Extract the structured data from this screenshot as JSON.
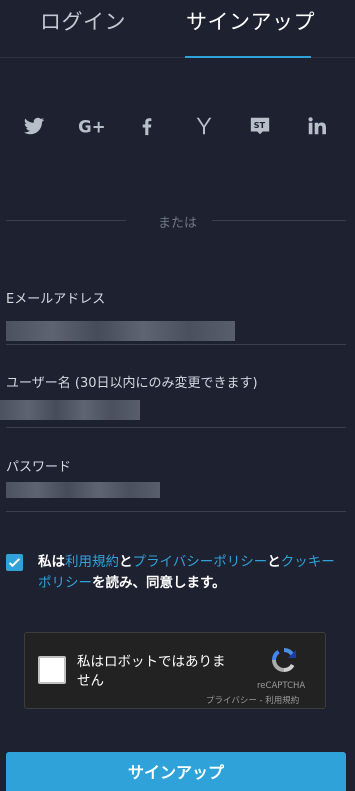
{
  "tabs": {
    "login": "ログイン",
    "signup": "サインアップ"
  },
  "social": [
    "twitter-icon",
    "google-plus-icon",
    "facebook-icon",
    "yahoo-icon",
    "stack-icon",
    "linkedin-icon"
  ],
  "divider": {
    "text": "または"
  },
  "form": {
    "email": {
      "label": "Eメールアドレス"
    },
    "username": {
      "label": "ユーザー名 (30日以内にのみ変更できます)"
    },
    "password": {
      "label": "パスワード"
    }
  },
  "agreement": {
    "checked": true,
    "prefix": "私は",
    "terms": "利用規約",
    "and1": "と",
    "privacy": "プライバシーポリシー",
    "and2": "と",
    "cookie": "クッキーポリシー",
    "suffix": "を読み、同意します。"
  },
  "recaptcha": {
    "label": "私はロボットではありません",
    "brand": "reCAPTCHA",
    "terms": "プライバシー - 利用規約"
  },
  "submit": {
    "label": "サインアップ"
  },
  "colors": {
    "accent": "#2fa3d9",
    "background": "#1d2130"
  }
}
